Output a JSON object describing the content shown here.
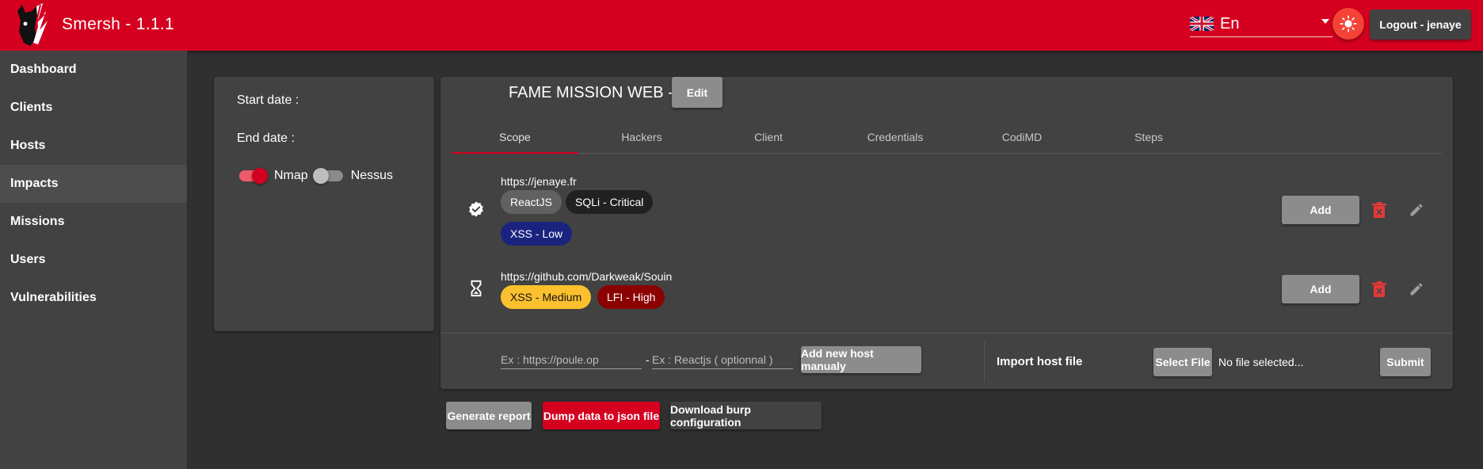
{
  "app": {
    "title": "Smersh - 1.1.1"
  },
  "header": {
    "language": "En",
    "logout_label": "Logout - jenaye"
  },
  "sidebar": {
    "items": [
      {
        "label": "Dashboard"
      },
      {
        "label": "Clients"
      },
      {
        "label": "Hosts"
      },
      {
        "label": "Impacts",
        "active": true
      },
      {
        "label": "Missions"
      },
      {
        "label": "Users"
      },
      {
        "label": "Vulnerabilities"
      }
    ]
  },
  "mission": {
    "start_date_label": "Start date :",
    "end_date_label": "End date :",
    "nmap_label": "Nmap",
    "nessus_label": "Nessus",
    "nmap_enabled": true,
    "nessus_enabled": false,
    "title": "FAME MISSION WEB -",
    "edit_label": "Edit"
  },
  "tabs": [
    {
      "label": "Scope",
      "active": true
    },
    {
      "label": "Hackers"
    },
    {
      "label": "Client"
    },
    {
      "label": "Credentials"
    },
    {
      "label": "CodiMD"
    },
    {
      "label": "Steps"
    }
  ],
  "hosts": [
    {
      "url": "https://jenaye.fr",
      "status_icon": "verified-check-icon",
      "chips": [
        {
          "label": "ReactJS",
          "color": "#616161"
        },
        {
          "label": "SQLi - Critical",
          "color": "#212121"
        },
        {
          "label": "XSS - Low",
          "color": "#1a237e"
        }
      ],
      "add_label": "Add"
    },
    {
      "url": "https://github.com/Darkweak/Souin",
      "status_icon": "hourglass-icon",
      "chips": [
        {
          "label": "XSS - Medium",
          "color": "#fbc02d",
          "text_color": "#111111"
        },
        {
          "label": "LFI - High",
          "color": "#8b0000"
        }
      ],
      "add_label": "Add"
    }
  ],
  "add_host": {
    "url_placeholder": "Ex : https://poule.op",
    "separator": "-",
    "tech_placeholder": "Ex : Reactjs ( optionnal )",
    "button_label": "Add new host manualy"
  },
  "import": {
    "label": "Import host file",
    "select_label": "Select File",
    "file_status": "No file selected...",
    "submit_label": "Submit"
  },
  "actions": {
    "generate_report": "Generate report",
    "dump_json": "Dump data to json file",
    "download_burp": "Download burp configuration"
  },
  "colors": {
    "brand": "#d50020",
    "surface": "#424242",
    "background": "#303030",
    "delete": "#e53935"
  }
}
